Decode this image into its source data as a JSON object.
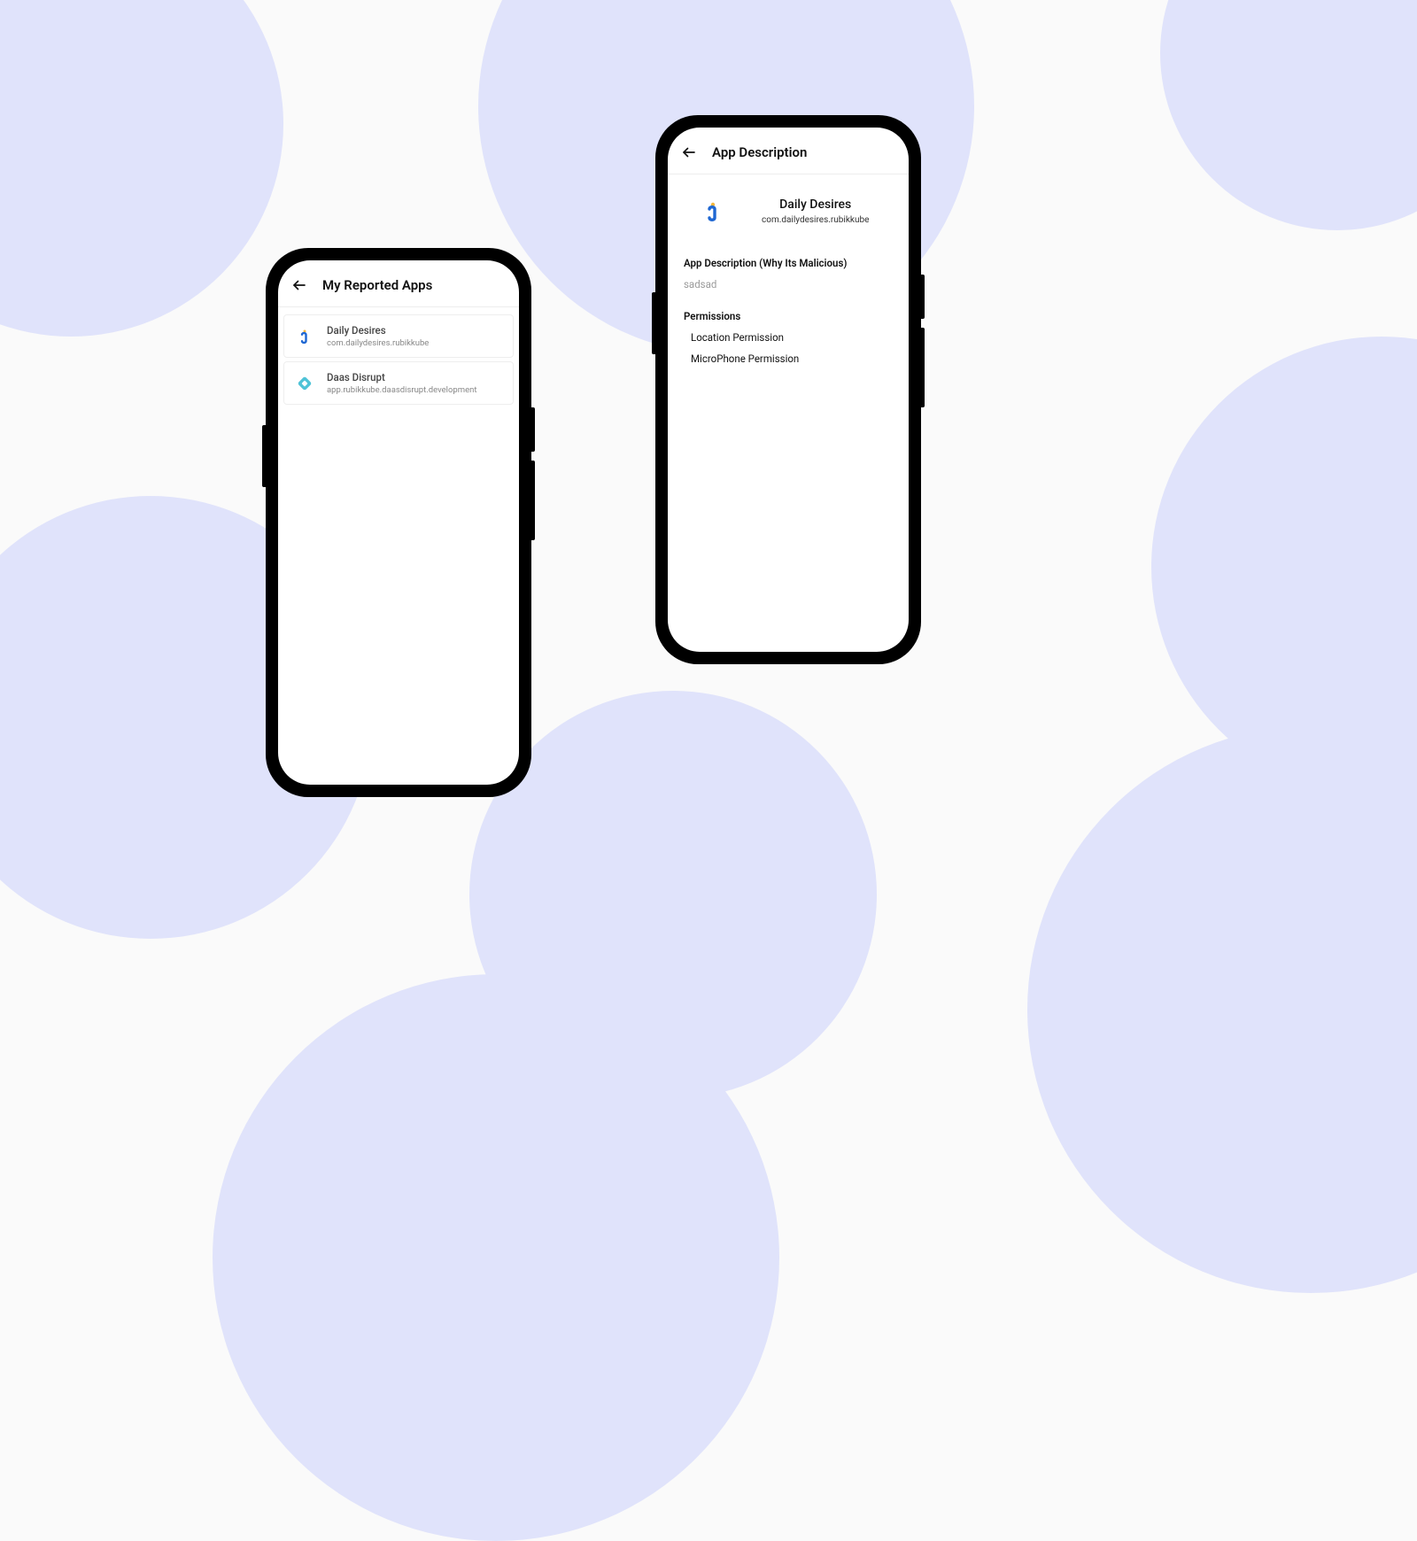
{
  "left": {
    "header_title": "My Reported Apps",
    "apps": [
      {
        "name": "Daily Desires",
        "pkg": "com.dailydesires.rubikkube",
        "icon": "daily-desires"
      },
      {
        "name": "Daas Disrupt",
        "pkg": "app.rubikkube.daasdisrupt.development",
        "icon": "daas"
      }
    ]
  },
  "right": {
    "header_title": "App Description",
    "app_name": "Daily Desires",
    "app_pkg": "com.dailydesires.rubikkube",
    "desc_label": "App Description (Why Its Malicious)",
    "desc_text": "sadsad",
    "perm_label": "Permissions",
    "permissions": [
      "Location Permission",
      "MicroPhone Permission"
    ]
  }
}
